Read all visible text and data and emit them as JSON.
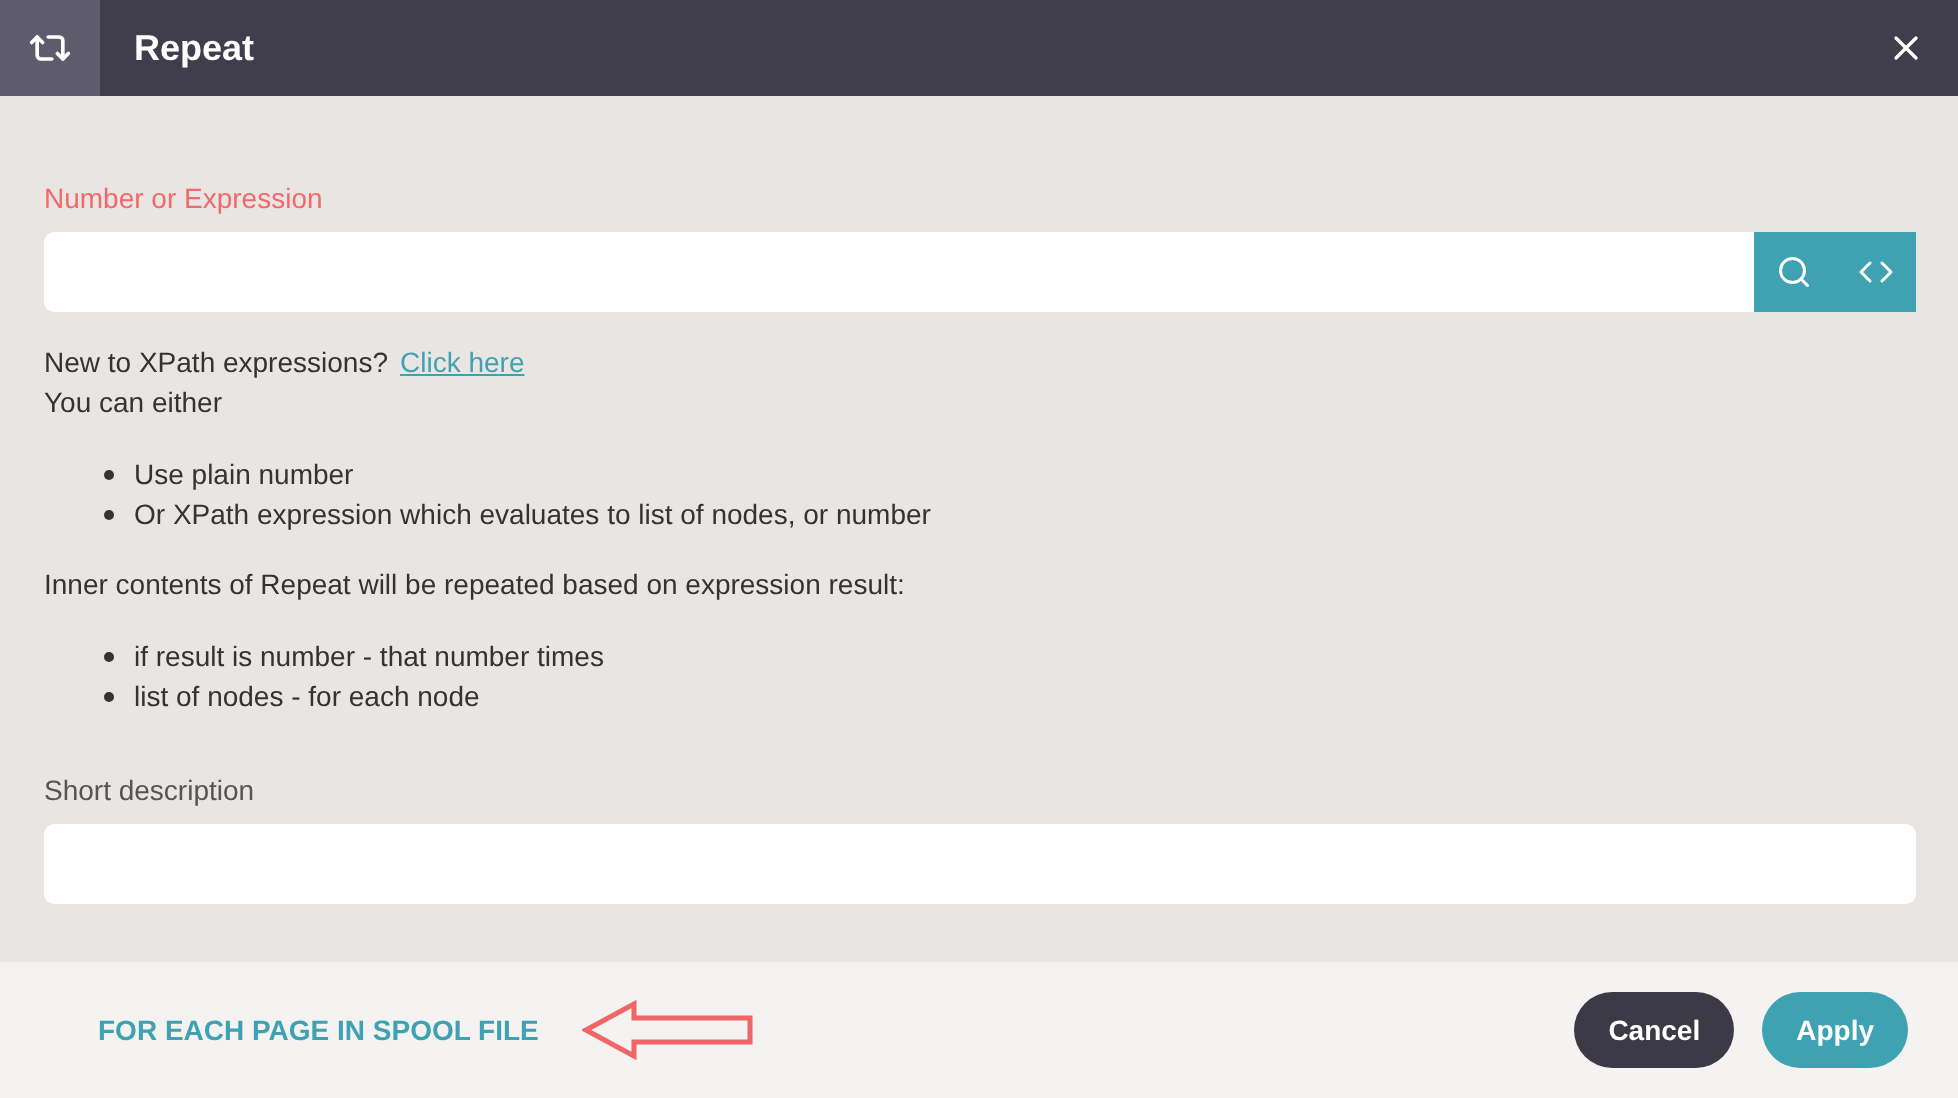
{
  "dialog": {
    "title": "Repeat"
  },
  "expression_field": {
    "label": "Number or Expression"
  },
  "help": {
    "intro": "New to XPath expressions?",
    "link": "Click here",
    "line": "You can either",
    "options": [
      "Use plain number",
      "Or XPath expression which evaluates to list of nodes, or number"
    ],
    "explanation": "Inner contents of Repeat will be repeated based on expression result:",
    "cases": [
      "if result is number - that number times",
      "list of nodes - for each node"
    ]
  },
  "description_field": {
    "label": "Short description"
  },
  "footer": {
    "link": "FOR EACH PAGE IN SPOOL FILE",
    "buttons": [
      {
        "label": "Cancel",
        "kind": "secondary"
      },
      {
        "label": "Apply",
        "kind": "primary"
      }
    ]
  }
}
